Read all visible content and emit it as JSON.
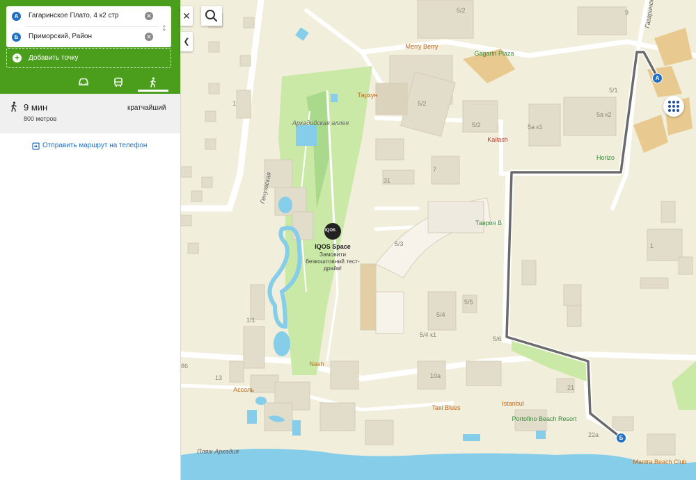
{
  "route": {
    "from_marker": "A",
    "from_value": "Гагаринское Плато, 4 к2 стр",
    "to_marker": "Б",
    "to_value": "Приморский, Район",
    "add_point_label": "Добавить точку",
    "modes": [
      "car-icon",
      "bus-icon",
      "walk-icon"
    ],
    "active_mode": "walk",
    "time": "9 мин",
    "distance": "800 метров",
    "route_tag": "кратчайший",
    "send_link": "Отправить маршрут на телефон"
  },
  "colors": {
    "accent_green": "#4a9e1c",
    "marker_blue": "#1f6fc5",
    "route_gray": "#6b6b6b",
    "water": "#86cde9",
    "park": "#cbe9a6",
    "building": "#e2dccb"
  },
  "map": {
    "pois": [
      {
        "name": "Merry Berry",
        "kind": "food"
      },
      {
        "name": "Gagarin Plaza",
        "kind": "shop"
      },
      {
        "name": "Тархун",
        "kind": "food"
      },
      {
        "name": "Kailash",
        "kind": "hotel"
      },
      {
        "name": "Horizo",
        "kind": "hotel"
      },
      {
        "name": "Таврия В",
        "kind": "shop"
      },
      {
        "name": "IQOS Space",
        "kind": "promo"
      },
      {
        "name": "Nash",
        "kind": "food"
      },
      {
        "name": "Ассоль",
        "kind": "food"
      },
      {
        "name": "Taxi Blues",
        "kind": "food"
      },
      {
        "name": "Istanbul",
        "kind": "food"
      },
      {
        "name": "Portofino Beach Resort",
        "kind": "hotel"
      },
      {
        "name": "Mantra Beach Club",
        "kind": "food"
      }
    ],
    "promo_text": "Замовити безкоштовний тест-драйв!",
    "promo_logo": "IQOS",
    "streets": [
      "Аркадийская аллея",
      "Генуэзская",
      "Гагаринск",
      "Пляж Аркадия"
    ],
    "buildings": [
      "5/2",
      "9",
      "5/1",
      "5/2",
      "5/2",
      "5а к1",
      "5а к2",
      "1",
      "7",
      "31",
      "5/3",
      "1",
      "5/5",
      "5/4",
      "5/4 к1",
      "5/6",
      "1/1",
      "86",
      "13",
      "10а",
      "21",
      "22а"
    ]
  }
}
